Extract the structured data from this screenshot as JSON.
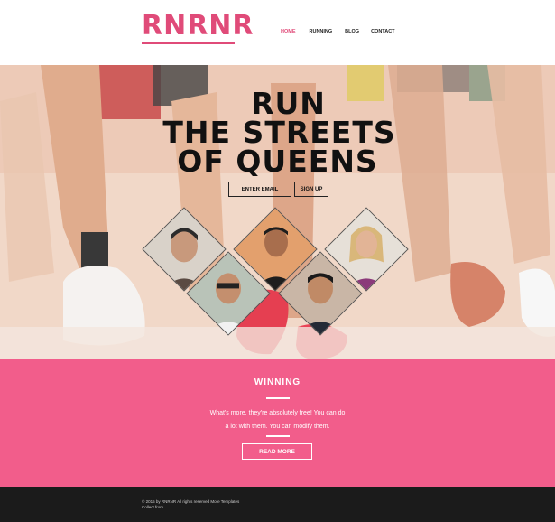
{
  "header": {
    "logo": "RNRNR",
    "nav": [
      {
        "label": "HOME",
        "active": true
      },
      {
        "label": "RUNNING",
        "active": false
      },
      {
        "label": "BLOG",
        "active": false
      },
      {
        "label": "CONTACT",
        "active": false
      }
    ]
  },
  "hero": {
    "title_line1": "RUN",
    "title_line2": "THE STREETS",
    "title_line3": "OF QUEENS",
    "email_placeholder": "ENTER EMAIL",
    "signup_label": "SIGN UP",
    "portraits": [
      "runner-portrait-1",
      "runner-portrait-2",
      "runner-portrait-3",
      "runner-portrait-4",
      "runner-portrait-5"
    ]
  },
  "section": {
    "title": "WINNING",
    "text_line1": "What's more, they're absolutely free! You can do",
    "text_line2": "a lot with them. You can modify them.",
    "button_label": "READ MORE"
  },
  "footer": {
    "copyright": "© 2015 by RNRNR All rights reserved More Templates",
    "link": "Collect from"
  },
  "colors": {
    "accent": "#e04b79",
    "pink_band": "#f25d8b",
    "footer_bg": "#1b1b1b"
  }
}
